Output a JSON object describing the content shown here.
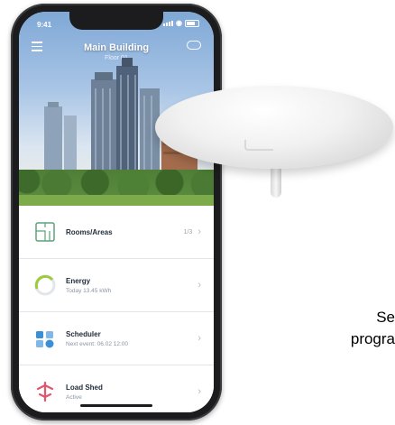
{
  "phone": {
    "status_time": "9:41",
    "header": {
      "title": "Main Building",
      "subtitle": "Floor 01"
    },
    "list_items": [
      {
        "label": "Rooms/Areas",
        "sublabel": "",
        "value": "1/3",
        "icon": "floorplan-icon",
        "color": "#5ba27a"
      },
      {
        "label": "Energy",
        "sublabel": "Today 13.45 kWh",
        "value": "",
        "icon": "energy-gauge-icon",
        "color": "#9ccb3b"
      },
      {
        "label": "Scheduler",
        "sublabel": "Next event: 06.02 12:00",
        "value": "",
        "icon": "scheduler-icon",
        "color": "#3b8fd6"
      },
      {
        "label": "Load Shed",
        "sublabel": "Active",
        "value": "",
        "icon": "load-shed-icon",
        "color": "#e2556b"
      }
    ]
  },
  "caption": {
    "line1": "Se",
    "line2": "progra"
  }
}
